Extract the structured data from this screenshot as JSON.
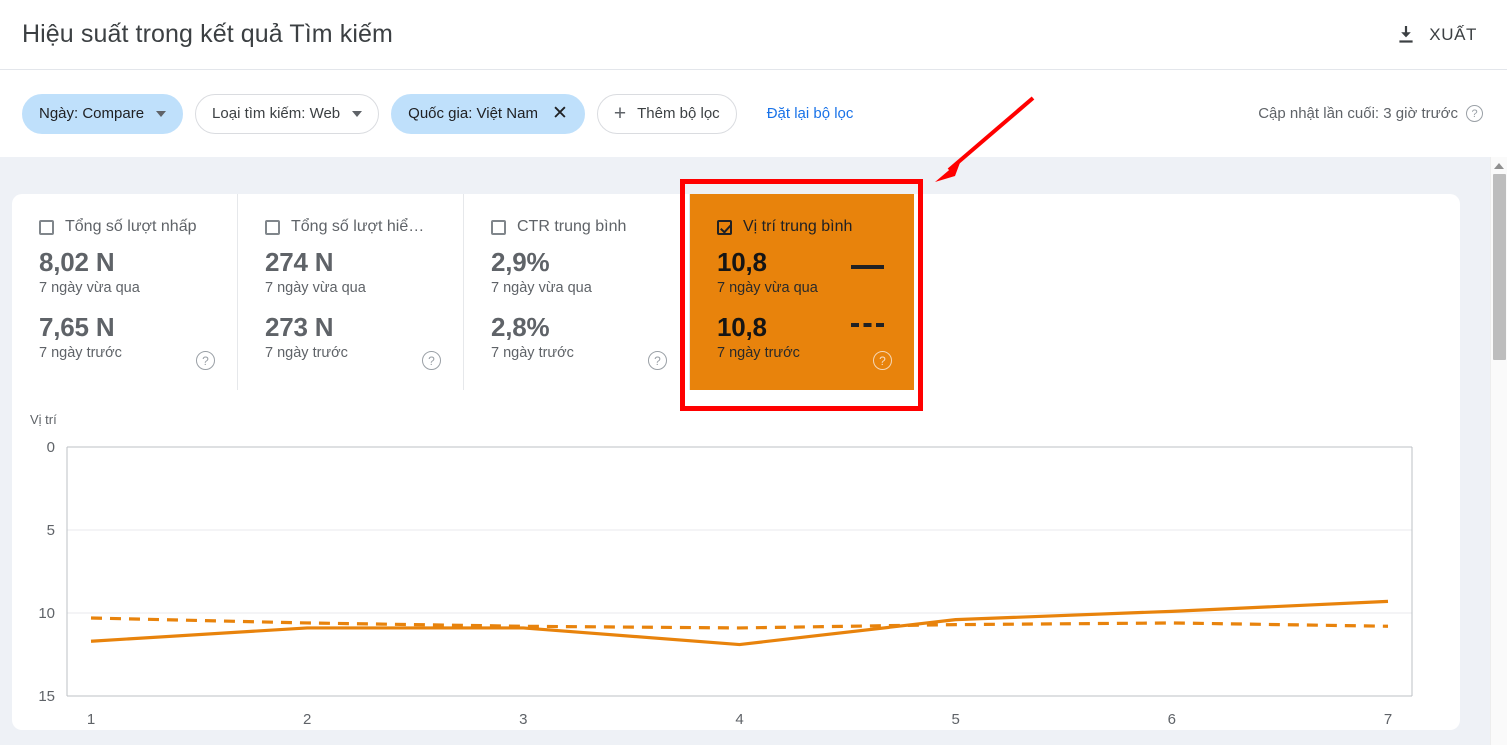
{
  "header": {
    "title": "Hiệu suất trong kết quả Tìm kiếm",
    "export_label": "XUẤT",
    "export_icon": "download-icon"
  },
  "filters": {
    "chips": [
      {
        "label": "Ngày: Compare",
        "type": "dropdown",
        "active": true
      },
      {
        "label": "Loại tìm kiếm: Web",
        "type": "dropdown",
        "active": false
      },
      {
        "label": "Quốc gia: Việt Nam",
        "type": "removable",
        "active": true
      },
      {
        "label": "Thêm bộ lọc",
        "type": "add",
        "active": false
      }
    ],
    "reset_label": "Đặt lại bộ lọc",
    "updated_label": "Cập nhật lần cuối: 3 giờ trước",
    "help_icon": "help-icon"
  },
  "cards": [
    {
      "title": "Tổng số lượt nhấp",
      "checked": false,
      "current_value": "8,02 N",
      "current_label": "7 ngày vừa qua",
      "previous_value": "7,65 N",
      "previous_label": "7 ngày trước",
      "help_icon": "help-icon"
    },
    {
      "title": "Tổng số lượt hiể…",
      "checked": false,
      "current_value": "274 N",
      "current_label": "7 ngày vừa qua",
      "previous_value": "273 N",
      "previous_label": "7 ngày trước",
      "help_icon": "help-icon"
    },
    {
      "title": "CTR trung bình",
      "checked": false,
      "current_value": "2,9%",
      "current_label": "7 ngày vừa qua",
      "previous_value": "2,8%",
      "previous_label": "7 ngày trước",
      "help_icon": "help-icon"
    },
    {
      "title": "Vị trí trung bình",
      "checked": true,
      "current_value": "10,8",
      "current_label": "7 ngày vừa qua",
      "previous_value": "10,8",
      "previous_label": "7 ngày trước",
      "help_icon": "help-icon"
    }
  ],
  "colors": {
    "highlight": "#e8830c",
    "series": "#e8830c",
    "accent_link": "#1a73e8",
    "chip_active": "#bfe0fb",
    "annotation": "#ff0000"
  },
  "chart_data": {
    "type": "line",
    "title": "",
    "ylabel": "Vị trí",
    "xlabel": "",
    "x": [
      1,
      2,
      3,
      4,
      5,
      6,
      7
    ],
    "categories": [
      "1",
      "2",
      "3",
      "4",
      "5",
      "6",
      "7"
    ],
    "yticks": [
      0,
      5,
      10,
      15
    ],
    "ylim": [
      0,
      15
    ],
    "y_inverted": true,
    "grid": true,
    "legend_position": "none",
    "series": [
      {
        "name": "Vị trí trung bình - 7 ngày vừa qua",
        "style": "solid",
        "color": "#e8830c",
        "values": [
          11.7,
          10.9,
          10.9,
          11.9,
          10.4,
          9.9,
          9.3
        ]
      },
      {
        "name": "Vị trí trung bình - 7 ngày trước",
        "style": "dashed",
        "color": "#e8830c",
        "values": [
          10.3,
          10.6,
          10.8,
          10.9,
          10.7,
          10.6,
          10.8
        ]
      }
    ]
  },
  "annotation": {
    "box_label": "highlight-box-around-position-card",
    "arrow_label": "pointer-arrow"
  },
  "scrollbar": {
    "up_icon": "chevron-up-icon"
  }
}
